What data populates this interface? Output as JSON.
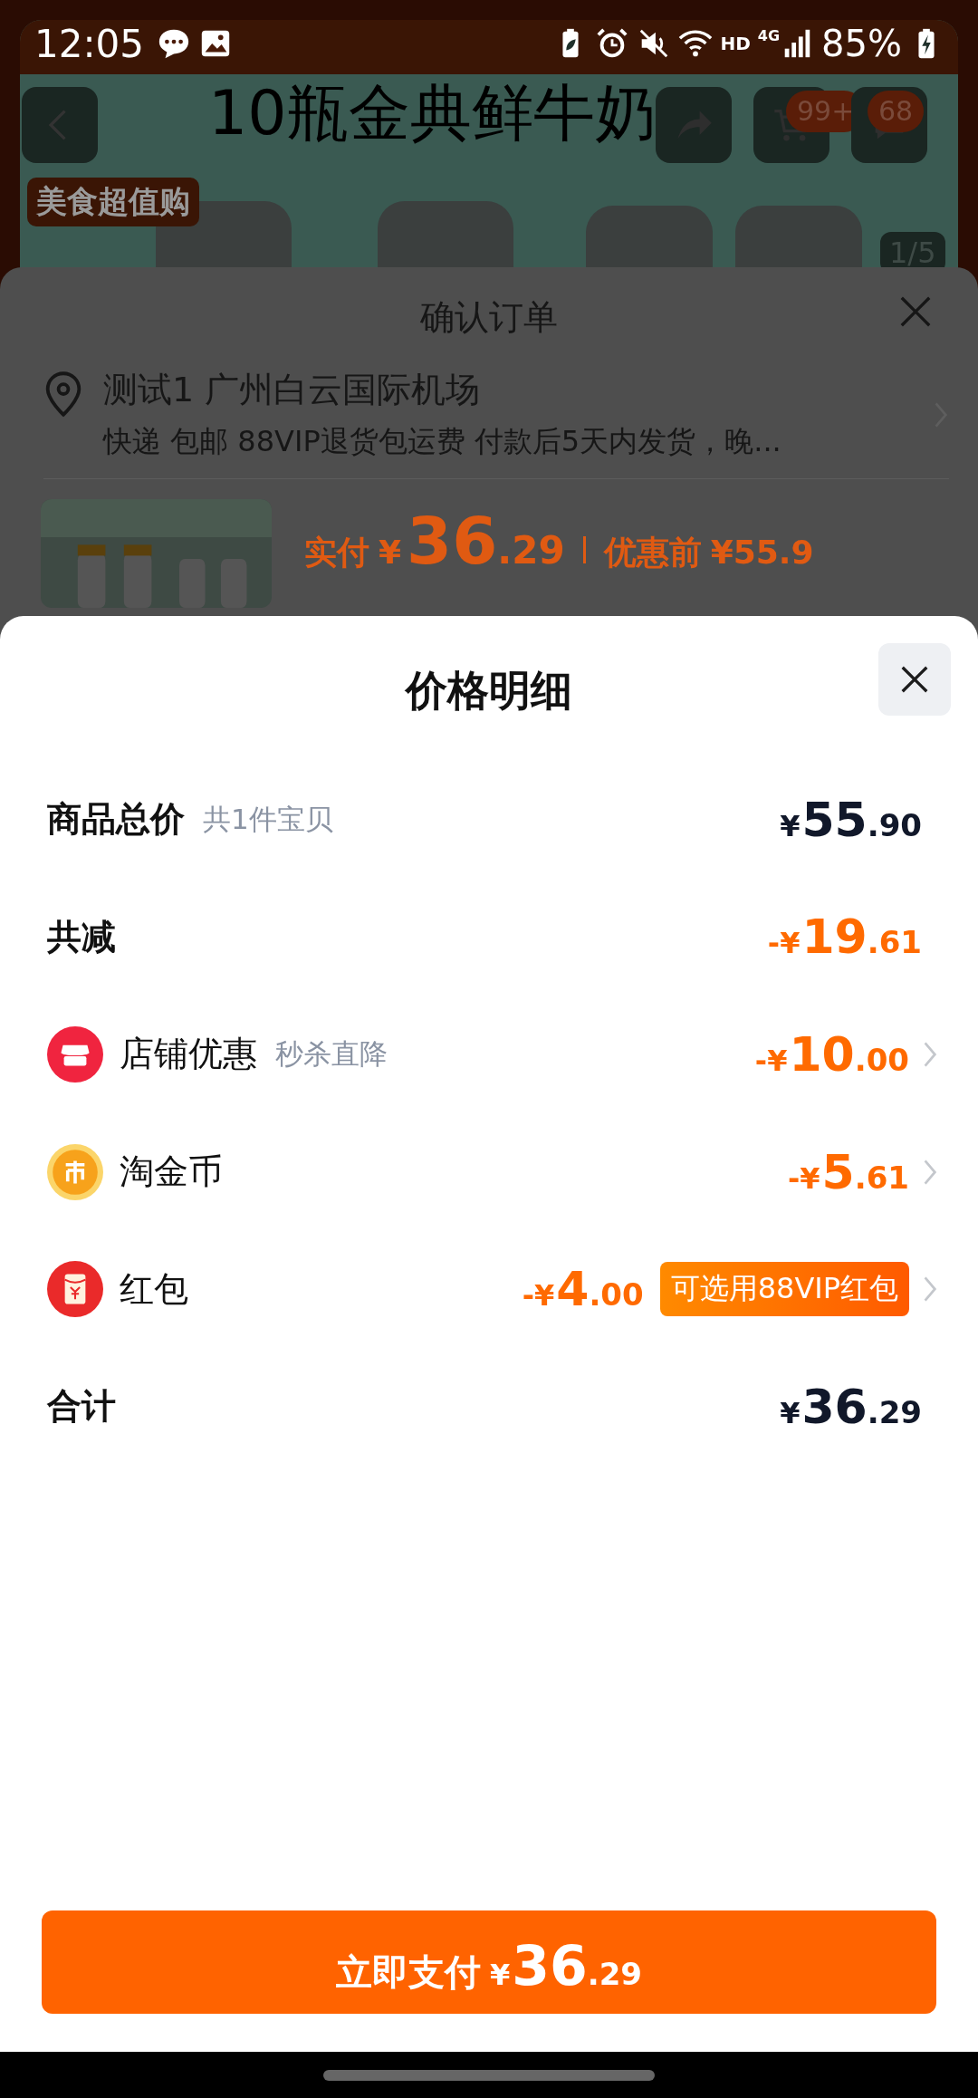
{
  "status_bar": {
    "time": "12:05",
    "hd": "HD",
    "network": "4G",
    "battery": "85%"
  },
  "background_page": {
    "logo": "美食超值购",
    "title": "10瓶金典鲜牛奶",
    "cart_badge": "99+",
    "message_badge": "68",
    "image_counter": "1/5"
  },
  "order_sheet": {
    "title": "确认订单",
    "address": "测试1 广州白云国际机场",
    "shipping": "快递 包邮 88VIP退货包运费 付款后5天内发货，晚...",
    "paid_label": "实付",
    "paid_prefix": "¥",
    "paid_whole": "36",
    "paid_fraction": ".29",
    "before_label": "优惠前",
    "before_price": "¥55.9"
  },
  "price_sheet": {
    "title": "价格明细",
    "rows": [
      {
        "kind": "summary",
        "label": "商品总价",
        "note": "共1件宝贝",
        "prefix": "¥",
        "whole": "55",
        "fraction": ".90",
        "discount": false
      },
      {
        "kind": "summary",
        "label": "共减",
        "prefix": "-¥",
        "whole": "19",
        "fraction": ".61",
        "discount": true
      },
      {
        "kind": "store",
        "label": "店铺优惠",
        "note": "秒杀直降",
        "prefix": "-¥",
        "whole": "10",
        "fraction": ".00",
        "discount": true
      },
      {
        "kind": "coin",
        "label": "淘金币",
        "prefix": "-¥",
        "whole": "5",
        "fraction": ".61",
        "discount": true
      },
      {
        "kind": "packet",
        "label": "红包",
        "prefix": "-¥",
        "whole": "4",
        "fraction": ".00",
        "discount": true,
        "tag": "可选用88VIP红包"
      },
      {
        "kind": "summary",
        "label": "合计",
        "prefix": "¥",
        "whole": "36",
        "fraction": ".29",
        "discount": false
      }
    ]
  },
  "pay_button": {
    "label": "立即支付",
    "prefix": "¥",
    "whole": "36",
    "fraction": ".29"
  }
}
